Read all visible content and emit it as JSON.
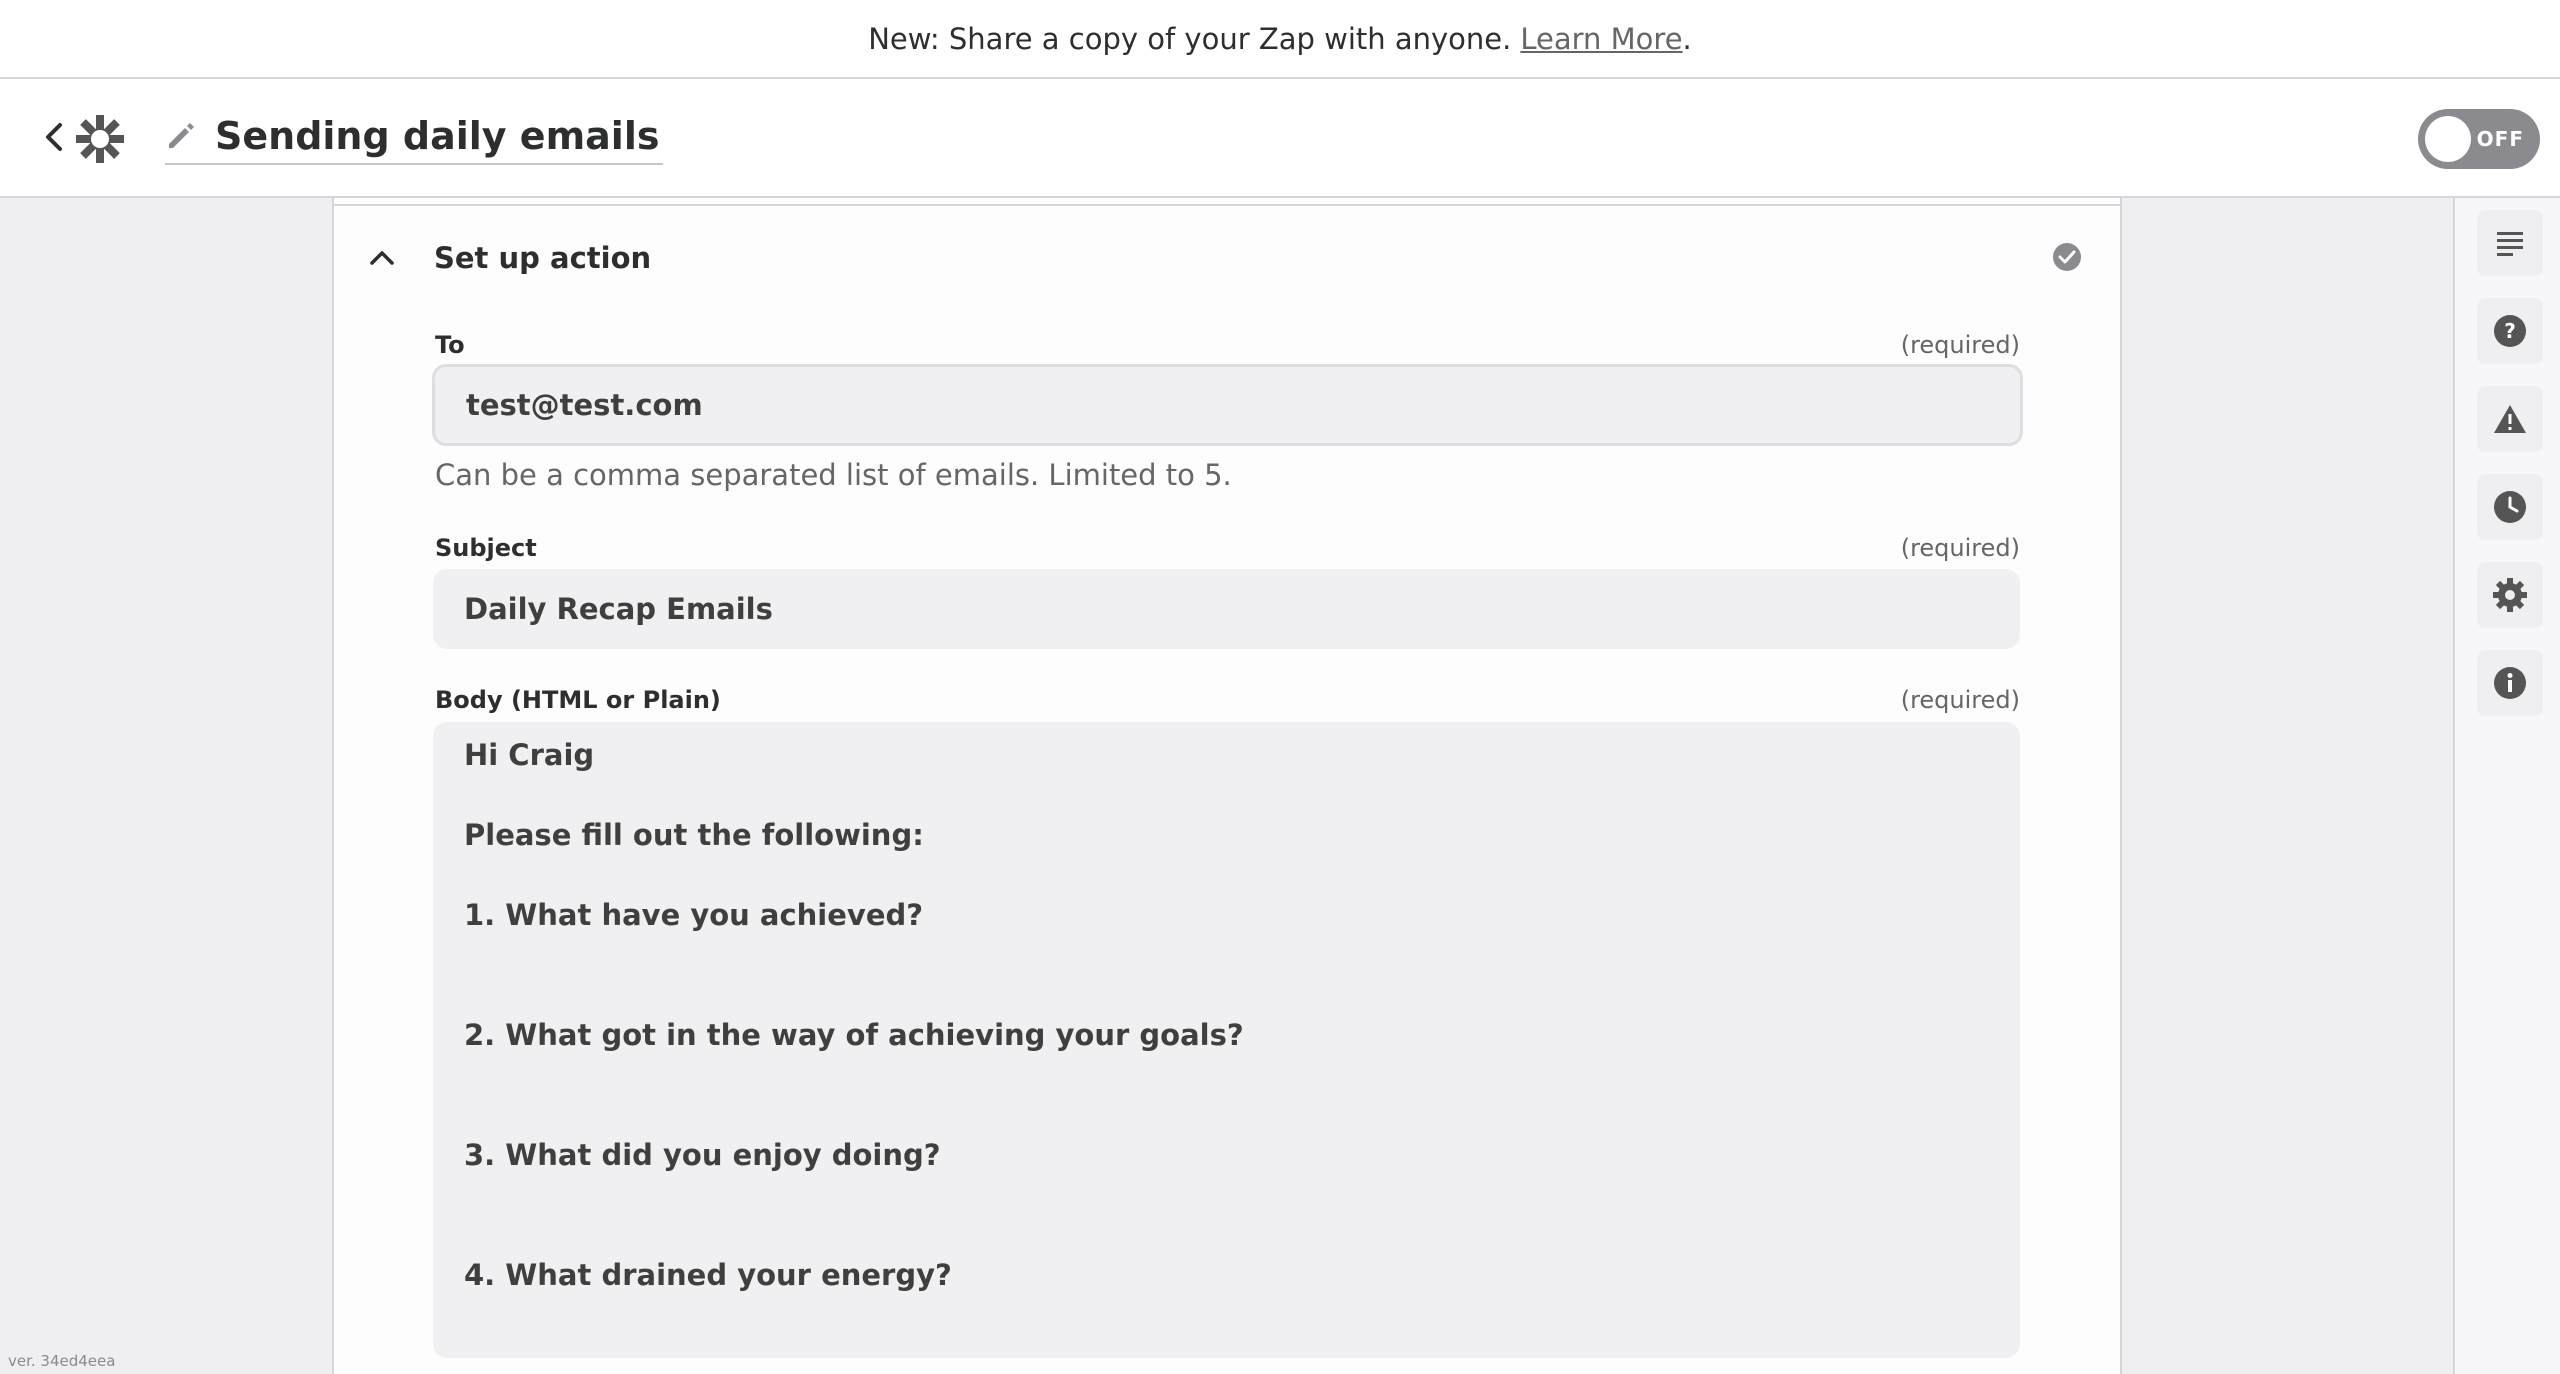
{
  "banner": {
    "text": "New: Share a copy of your Zap with anyone.",
    "link": "Learn More",
    "suffix": "."
  },
  "header": {
    "title": "Sending daily emails",
    "toggle_label": "OFF"
  },
  "section": {
    "title": "Set up action"
  },
  "fields": {
    "to": {
      "label": "To",
      "required": "(required)",
      "value": "test@test.com",
      "help": "Can be a comma separated list of emails. Limited to 5."
    },
    "subject": {
      "label": "Subject",
      "required": "(required)",
      "value": "Daily Recap Emails"
    },
    "body": {
      "label": "Body (HTML or Plain)",
      "required": "(required)",
      "lines": [
        "Hi Craig",
        "Please fill out the following:",
        "1. What have you achieved?",
        "2. What got in the way of achieving your goals?",
        "3. What did you enjoy doing?",
        "4. What drained your energy?"
      ]
    }
  },
  "sidebar_icons": [
    "details-icon",
    "help-icon",
    "warning-icon",
    "history-icon",
    "settings-icon",
    "info-icon"
  ],
  "version": "ver. 34ed4eea",
  "colors": {
    "background": "#efeef0",
    "field_bg": "#f0eff1",
    "toggle_off": "#8b8a8f",
    "text": "#2d2e2e"
  }
}
